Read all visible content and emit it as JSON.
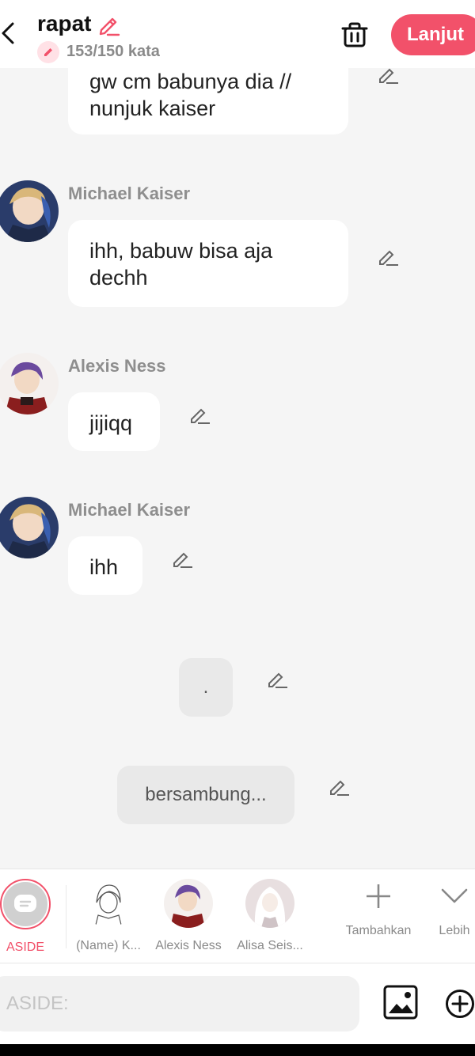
{
  "header": {
    "title": "rapat",
    "word_count": "153/150 kata",
    "next_label": "Lanjut",
    "accent": "#f2516a"
  },
  "messages": [
    {
      "type": "bubble",
      "text": "gw cm babunya dia // nunjuk kaiser"
    },
    {
      "type": "bubble",
      "sender": "Michael Kaiser",
      "text": "ihh, babuw bisa aja dechh"
    },
    {
      "type": "bubble",
      "sender": "Alexis Ness",
      "text": "jijiqq"
    },
    {
      "type": "bubble",
      "sender": "Michael Kaiser",
      "text": "ihh"
    },
    {
      "type": "narration",
      "text": "."
    },
    {
      "type": "narration",
      "text": "bersambung..."
    }
  ],
  "characters": [
    {
      "name": "ASIDE",
      "active": true
    },
    {
      "name": "(Name) K..."
    },
    {
      "name": "Alexis Ness"
    },
    {
      "name": "Alisa Seis..."
    }
  ],
  "tools": {
    "add_label": "Tambahkan",
    "more_label": "Lebih"
  },
  "input": {
    "placeholder": "ASIDE:"
  }
}
